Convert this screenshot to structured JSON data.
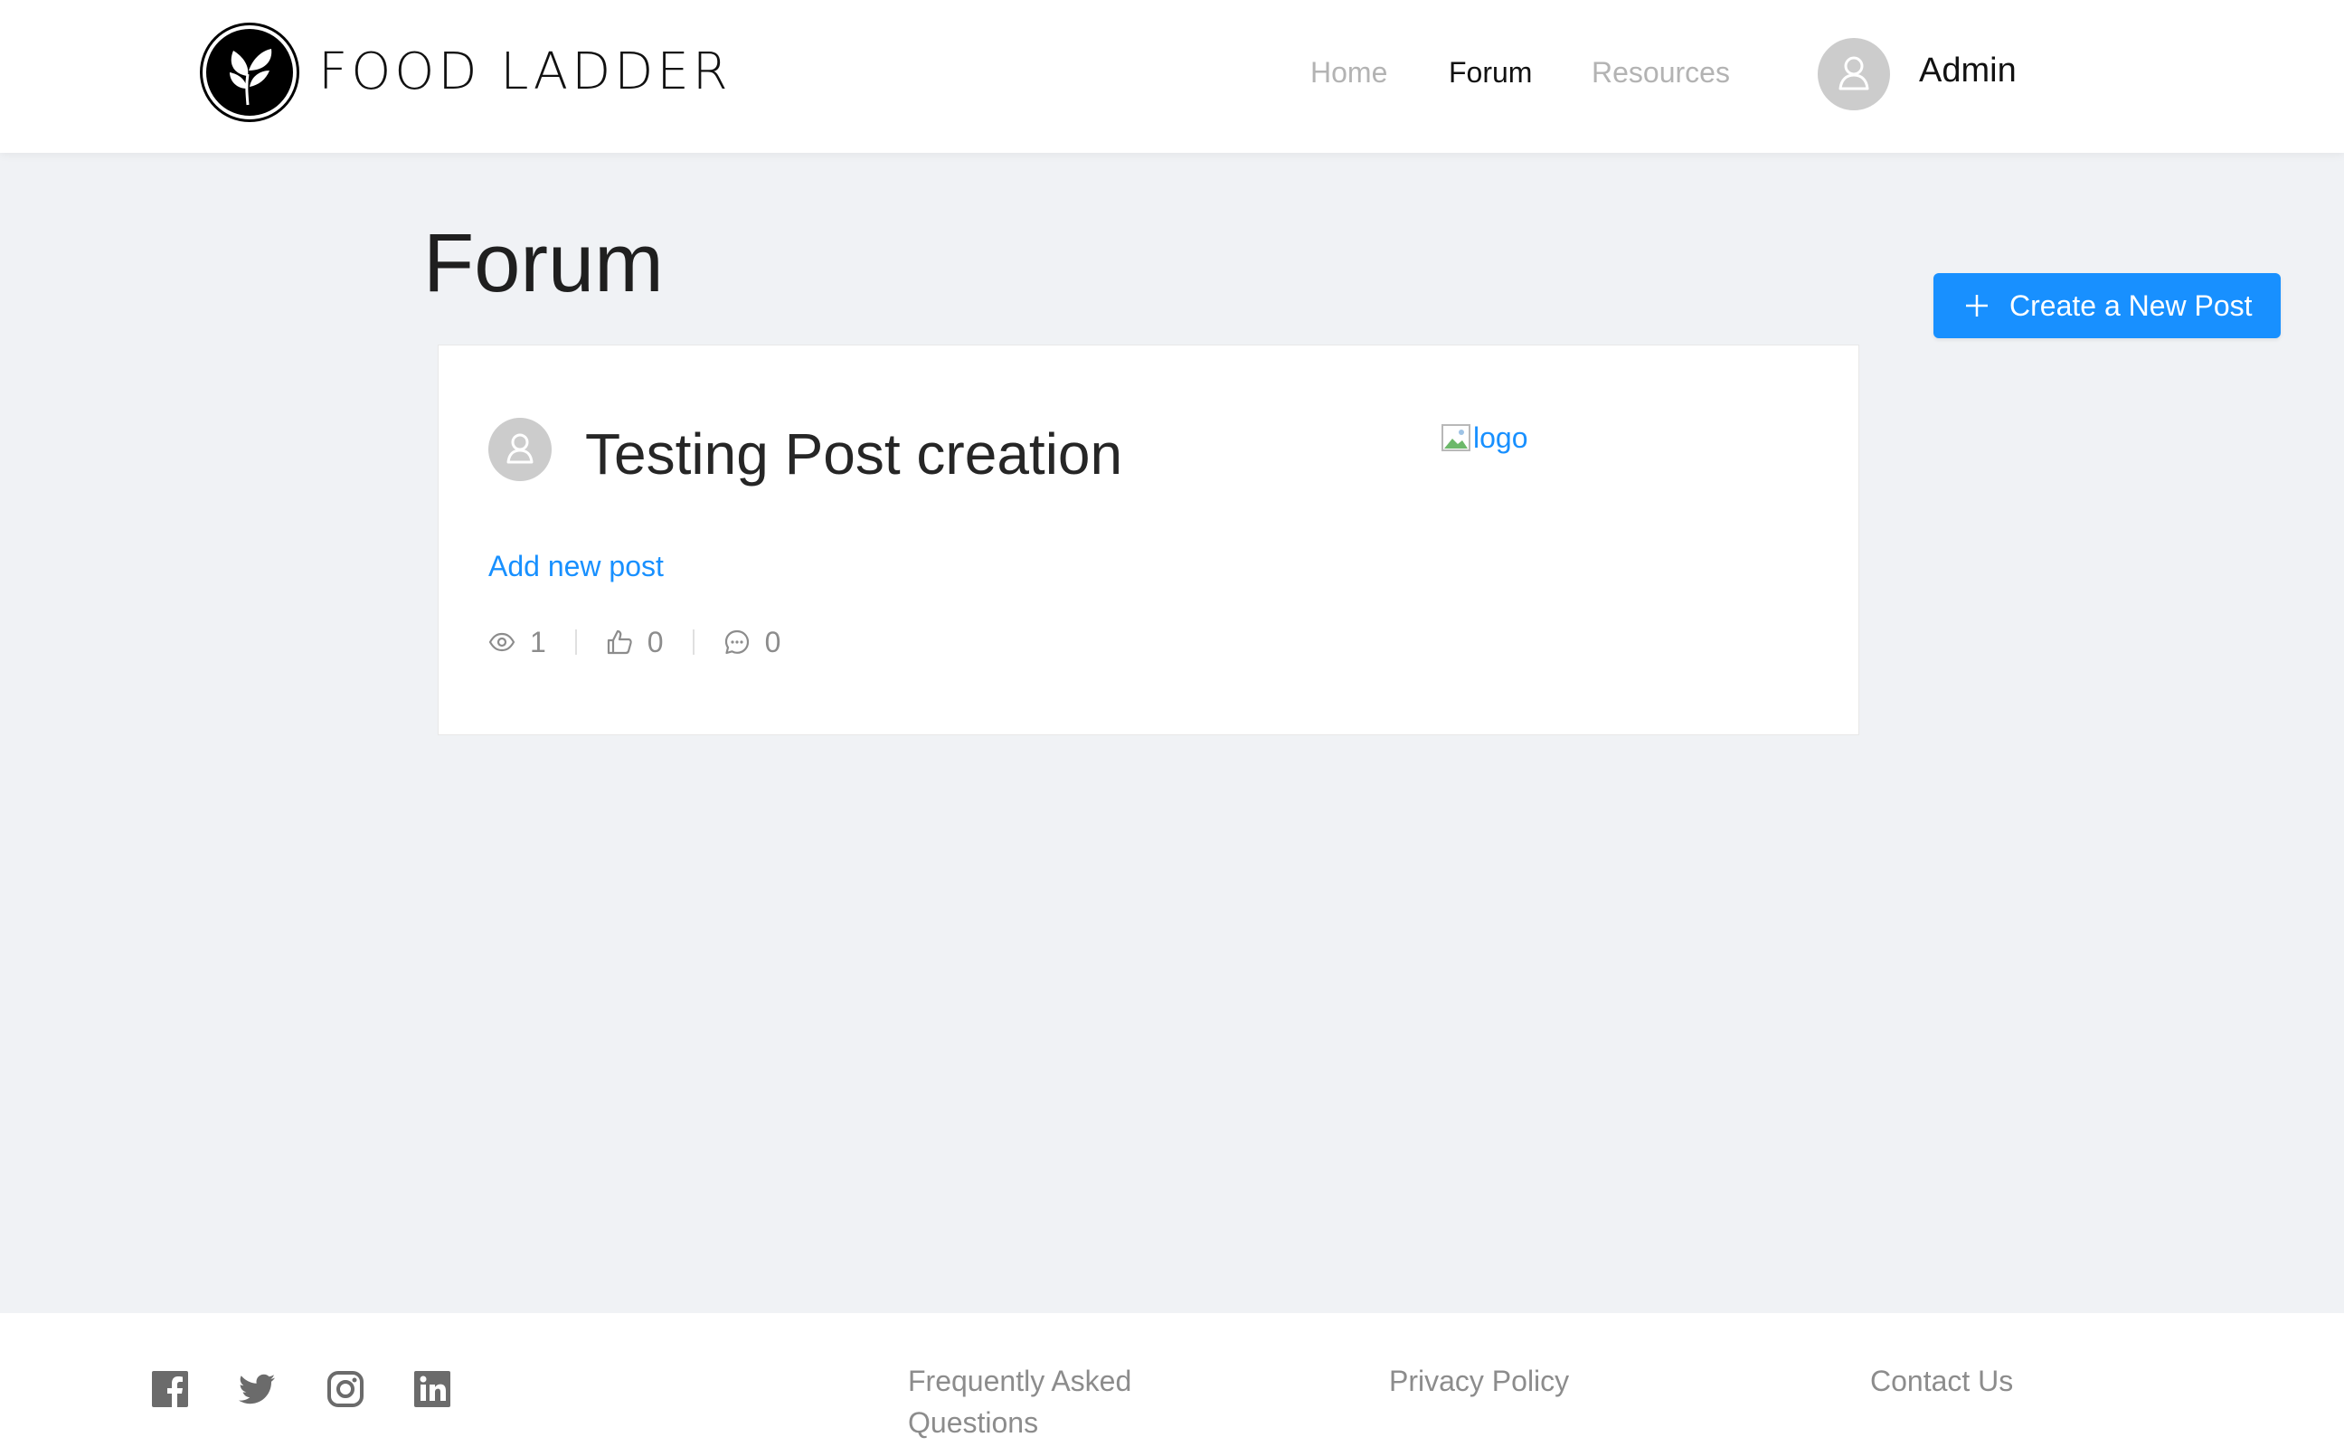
{
  "header": {
    "brand": "FOOD LADDER",
    "nav": {
      "home": "Home",
      "forum": "Forum",
      "resources": "Resources"
    },
    "user_name": "Admin"
  },
  "main": {
    "title": "Forum",
    "create_button": "Create a New Post",
    "post": {
      "title": "Testing Post creation",
      "image_alt": "logo",
      "link_text": "Add new post",
      "views": "1",
      "likes": "0",
      "comments": "0"
    }
  },
  "footer": {
    "social": [
      "facebook-icon",
      "twitter-icon",
      "instagram-icon",
      "linkedin-icon"
    ],
    "faq": "Frequently Asked Questions",
    "privacy": "Privacy Policy",
    "contact": "Contact Us"
  },
  "colors": {
    "accent": "#1890ff",
    "page_background": "#f0f2f5",
    "muted_text": "#8c8c8c",
    "avatar_gray": "#cccccc"
  }
}
